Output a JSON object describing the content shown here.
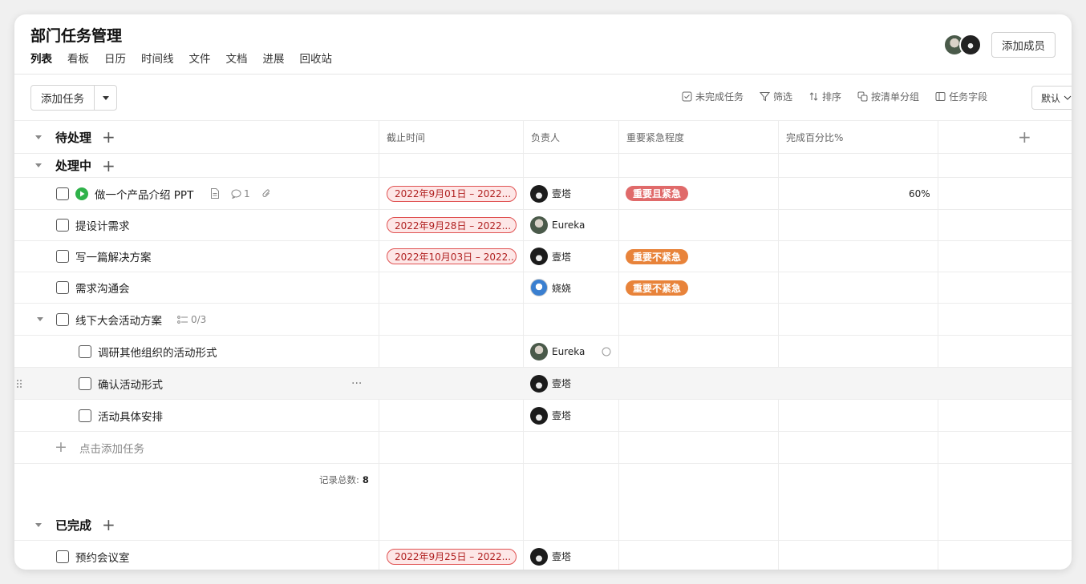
{
  "header": {
    "title": "部门任务管理",
    "tabs": [
      "列表",
      "看板",
      "日历",
      "时间线",
      "文件",
      "文档",
      "进展",
      "回收站"
    ],
    "add_member": "添加成员"
  },
  "toolbar": {
    "add_task": "添加任务",
    "tools": [
      {
        "icon": "checkbox-icon",
        "label": "未完成任务"
      },
      {
        "icon": "filter-icon",
        "label": "筛选"
      },
      {
        "icon": "sort-icon",
        "label": "排序"
      },
      {
        "icon": "group-icon",
        "label": "按清单分组"
      },
      {
        "icon": "columns-icon",
        "label": "任务字段"
      }
    ],
    "view_select": "默认"
  },
  "columns": {
    "deadline": "截止时间",
    "assignee": "负责人",
    "priority": "重要紧急程度",
    "progress": "完成百分比%",
    "add": "+"
  },
  "groups": {
    "todo": "待处理",
    "doing": "处理中",
    "done": "已完成"
  },
  "tasks": [
    {
      "name": "做一个产品介绍 PPT",
      "date": "2022年9月01日 – 2022...",
      "assignee": "壹塔",
      "priority": "重要且紧急",
      "progress": "60%",
      "comments": "1"
    },
    {
      "name": "提设计需求",
      "date": "2022年9月28日 – 2022...",
      "assignee": "Eureka"
    },
    {
      "name": "写一篇解决方案",
      "date": "2022年10月03日 – 2022...",
      "assignee": "壹塔",
      "priority": "重要不紧急"
    },
    {
      "name": "需求沟通会",
      "assignee": "娆娆",
      "priority": "重要不紧急"
    },
    {
      "name": "线下大会活动方案",
      "subtasks": "0/3"
    },
    {
      "name": "调研其他组织的活动形式",
      "assignee": "Eureka"
    },
    {
      "name": "确认活动形式",
      "assignee": "壹塔",
      "more": "···"
    },
    {
      "name": "活动具体安排",
      "assignee": "壹塔"
    }
  ],
  "add_task_inline": "点击添加任务",
  "record_count": {
    "label": "记录总数:",
    "value": "8"
  },
  "done_tasks": [
    {
      "name": "预约会议室",
      "date": "2022年9月25日 – 2022...",
      "assignee": "壹塔"
    }
  ],
  "colors": {
    "urgent_important": "#e06a6a",
    "important_not_urgent": "#e8833a",
    "date_border": "#e05252",
    "date_bg": "#fde7e7",
    "status_green": "#2fb24a"
  }
}
